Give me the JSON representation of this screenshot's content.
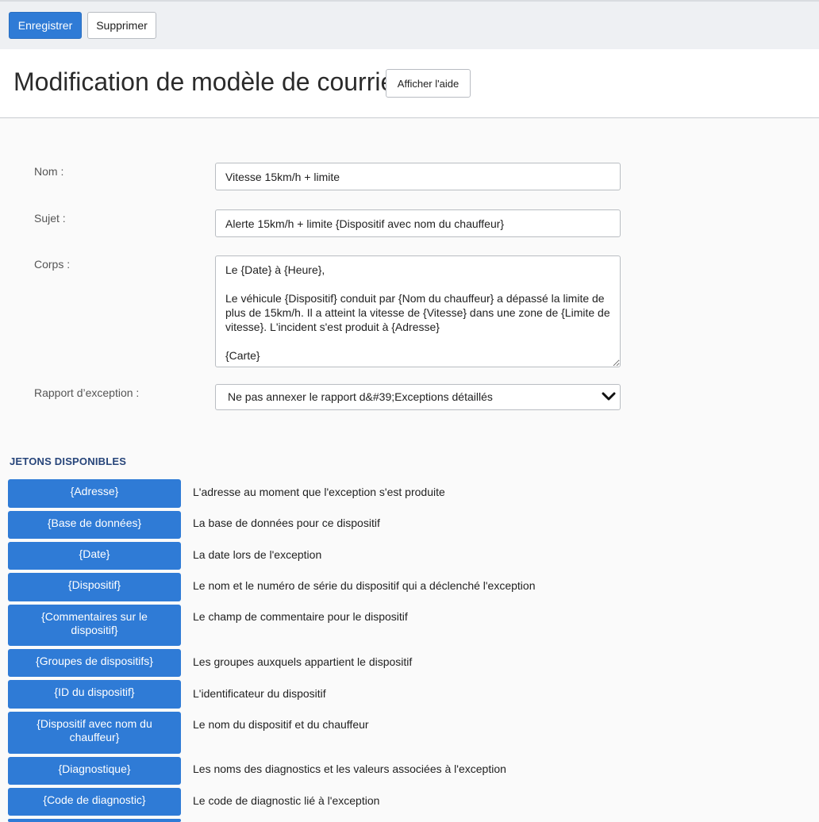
{
  "toolbar": {
    "save_label": "Enregistrer",
    "delete_label": "Supprimer"
  },
  "header": {
    "title": "Modification de modèle de courriel",
    "help_label": "Afficher l'aide"
  },
  "form": {
    "name_label": "Nom :",
    "name_value": "Vitesse 15km/h + limite",
    "subject_label": "Sujet :",
    "subject_value": "Alerte 15km/h + limite {Dispositif avec nom du chauffeur}",
    "body_label": "Corps :",
    "body_value": "Le {Date} à {Heure},\n\nLe véhicule {Dispositif} conduit par {Nom du chauffeur} a dépassé la limite de plus de 15km/h. Il a atteint la vitesse de {Vitesse} dans une zone de {Limite de vitesse}. L'incident s'est produit à {Adresse}\n\n{Carte}",
    "exception_label": "Rapport d’exception :",
    "exception_value": "Ne pas annexer le rapport d&#39;Exceptions détaillés",
    "chevron_icon": "chevron-down-icon"
  },
  "tokens": {
    "title": "JETONS DISPONIBLES",
    "items": [
      {
        "token": "{Adresse}",
        "description": "L'adresse au moment que l'exception s'est produite"
      },
      {
        "token": "{Base de données}",
        "description": "La base de données pour ce dispositif"
      },
      {
        "token": "{Date}",
        "description": "La date lors de l'exception"
      },
      {
        "token": "{Dispositif}",
        "description": "Le nom et le numéro de série du dispositif qui a déclenché l'exception"
      },
      {
        "token": "{Commentaires sur le dispositif}",
        "description": "Le champ de commentaire pour le dispositif"
      },
      {
        "token": "{Groupes de dispositifs}",
        "description": "Les groupes auxquels appartient le dispositif"
      },
      {
        "token": "{ID du dispositif}",
        "description": "L'identificateur du dispositif"
      },
      {
        "token": "{Dispositif avec nom du chauffeur}",
        "description": "Le nom du dispositif et du chauffeur"
      },
      {
        "token": "{Diagnostique}",
        "description": "Les noms des diagnostics et les valeurs associées à l'exception"
      },
      {
        "token": "{Code de diagnostic}",
        "description": "Le code de diagnostic lié à l'exception"
      }
    ]
  }
}
